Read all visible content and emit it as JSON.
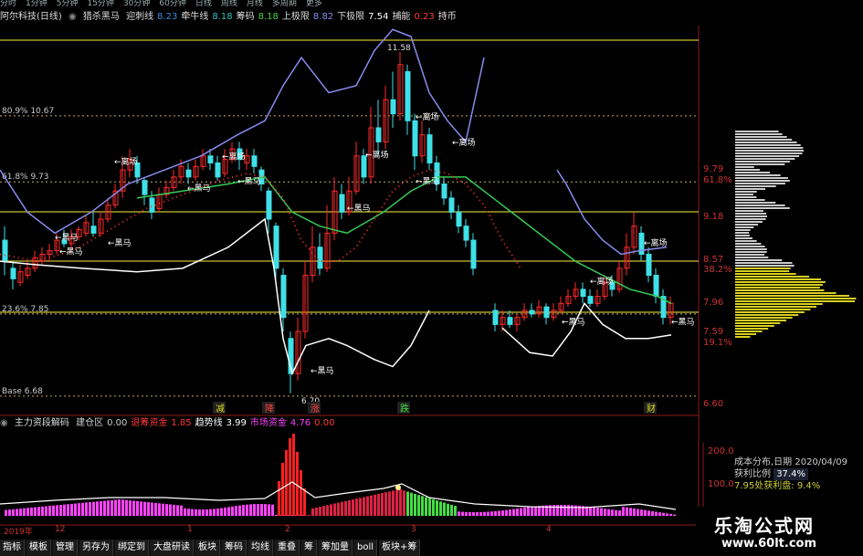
{
  "topbar": {
    "items": [
      "分时",
      "1分钟",
      "5分钟",
      "15分钟",
      "30分钟",
      "60分钟",
      "日线",
      "周线",
      "月线",
      "多周期",
      "更多"
    ]
  },
  "infobar": {
    "title": "阿尔科技(日线)",
    "indicator": "猎杀黑马",
    "items": [
      {
        "label": "迎刺线",
        "value": "8.23",
        "color": "#3a8fd8"
      },
      {
        "label": "牵牛线",
        "value": "8.18",
        "color": "#2bc3b8"
      },
      {
        "label": "筹码",
        "value": "8.18",
        "color": "#44d244"
      },
      {
        "label": "上极限",
        "value": "8.82",
        "color": "#8a8af0"
      },
      {
        "label": "下极限",
        "value": "7.54",
        "color": "#ffffff"
      },
      {
        "label": "捕能",
        "value": "0.23",
        "color": "#ff3a3a"
      },
      {
        "label": "持币",
        "value": "",
        "color": "#ffffff"
      }
    ]
  },
  "levels": [
    {
      "label": "80.9% 10.67",
      "y": 117
    },
    {
      "label": "61.8% 9.73",
      "y": 193
    },
    {
      "label": "23.6% 7.85",
      "y": 342
    },
    {
      "label": "Base 6.68",
      "y": 438
    }
  ],
  "price_labels": [
    {
      "text": "11.58"
    },
    {
      "text": "6.70"
    }
  ],
  "right_axis": {
    "labels": [
      {
        "text": "9.79",
        "color": "#c33"
      },
      {
        "text": "61.8%",
        "color": "#c33"
      },
      {
        "text": "9.18",
        "color": "#c33"
      },
      {
        "text": "8.57",
        "color": "#c33"
      },
      {
        "text": "38.2%",
        "color": "#c33"
      },
      {
        "text": "7.96",
        "color": "#c33"
      },
      {
        "text": "7.59",
        "color": "#c33"
      },
      {
        "text": "19.1%",
        "color": "#c33"
      },
      {
        "text": "6.60",
        "color": "#c33"
      }
    ],
    "sub_labels": [
      {
        "text": "200.0"
      },
      {
        "text": "100.0"
      }
    ]
  },
  "annotations": {
    "exit_label": "离场",
    "horse_label": "黑马",
    "events": [
      "减",
      "降",
      "涨",
      "跌",
      "财"
    ]
  },
  "subbar": {
    "title": "主力资段解码",
    "items": [
      {
        "label": "建仓区",
        "value": "0.00",
        "color": "#cccccc"
      },
      {
        "label": "退筹资金",
        "value": "1.85",
        "color": "#ff3a3a"
      },
      {
        "label": "趋势线",
        "value": "3.99",
        "color": "#ffffff"
      },
      {
        "label": "市场资金",
        "value": "4.76",
        "color": "#ff44ff"
      },
      {
        "label": "",
        "value": "0.00",
        "color": "#ff3a3a"
      }
    ]
  },
  "dates": {
    "items": [
      "2019年",
      "12",
      "1",
      "2",
      "3",
      "4"
    ]
  },
  "costbox": {
    "title": "成本分布,日期",
    "date": "2020/04/09",
    "profit_label": "获利比例",
    "profit_value": "37.4%",
    "extra": "7.95处获利盘: 9.4%"
  },
  "bottomtabs": {
    "items": [
      "指标",
      "模板",
      "管理",
      "另存为",
      "绑定到",
      "大盘研读",
      "板块",
      "筹码",
      "均线",
      "重叠",
      "筹",
      "筹加量",
      "boll",
      "板块+筹"
    ]
  },
  "brand": {
    "name": "乐淘公式网",
    "url": "www.60lt.com"
  },
  "chart_data": {
    "type": "candlestick",
    "ylim": [
      6.6,
      11.8
    ],
    "levels": [
      10.67,
      9.73,
      7.85,
      6.68
    ]
  },
  "colors": {
    "up": "#ff2a2a",
    "down": "#3fe0e8",
    "band": "#8a8af0",
    "ma": "#33cc55",
    "bg": "#000000"
  }
}
